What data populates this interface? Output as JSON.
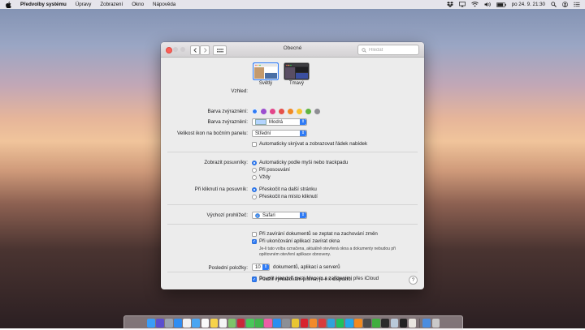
{
  "menubar": {
    "apple_icon": "apple-icon",
    "app_name": "Předvolby systému",
    "items": [
      "Úpravy",
      "Zobrazení",
      "Okno",
      "Nápověda"
    ],
    "clock": "po 24. 9.  21:30",
    "status_icons": [
      "dropbox-icon",
      "cast-icon",
      "wifi-icon",
      "volume-icon",
      "battery-icon",
      "spotlight-icon",
      "user-icon",
      "notification-center-icon"
    ]
  },
  "window": {
    "title": "Obecné",
    "search_placeholder": "Hledat",
    "appearance": {
      "label": "Vzhled:",
      "options": [
        {
          "label": "Světlý",
          "selected": true
        },
        {
          "label": "Tmavý",
          "selected": false
        }
      ]
    },
    "accent": {
      "label": "Barva zvýraznění:",
      "colors": [
        "#2f7bf5",
        "#9b4ecf",
        "#e3468a",
        "#e5504a",
        "#f08a24",
        "#f7c431",
        "#5fb541",
        "#8e8e93"
      ],
      "selected_index": 0
    },
    "highlight": {
      "label": "Barva zvýraznění:",
      "value": "Modrá",
      "swatch": "#b3d4ff"
    },
    "sidebar_icon_size": {
      "label": "Velikost ikon na bočním panelu:",
      "value": "Střední"
    },
    "auto_hide_menu": {
      "label": "Automaticky skrývat a zobrazovat řádek nabídek",
      "checked": false
    },
    "scrollbars": {
      "label": "Zobrazit posuvníky:",
      "options": [
        "Automaticky podle myši nebo trackpadu",
        "Při posouvání",
        "Vždy"
      ],
      "selected_index": 0
    },
    "click_scrollbar": {
      "label": "Při kliknutí na posuvník:",
      "options": [
        "Přeskočit na další stránku",
        "Přeskočit na místo kliknutí"
      ],
      "selected_index": 0
    },
    "default_browser": {
      "label": "Výchozí prohlížeč:",
      "value": "Safari",
      "icon": "safari-icon"
    },
    "ask_keep_changes": {
      "label": "Při zavírání dokumentů se zeptat na zachování změn",
      "checked": false
    },
    "close_windows": {
      "label": "Při ukončování aplikací zavírat okna",
      "checked": true,
      "note": "Je-li tato volba označena, aktuálně otevřená okna a dokumenty nebudou při opětovném otevření aplikace obnoveny."
    },
    "recent_items": {
      "label": "Poslední položky:",
      "value": "10",
      "suffix": "dokumentů, aplikací a serverů"
    },
    "handoff": {
      "label": "Povolit Handoff mezi Macem a zařízeními přes iCloud",
      "checked": true
    },
    "font_smoothing": {
      "label": "Použít vyhlazování písma, je-li k dispozici",
      "checked": true
    },
    "help_label": "?"
  },
  "dock": {
    "apps": [
      {
        "name": "finder-icon",
        "color": "#3a9df7"
      },
      {
        "name": "siri-icon",
        "color": "#5b4fcf"
      },
      {
        "name": "launchpad-icon",
        "color": "#9aa4b1"
      },
      {
        "name": "safari-icon",
        "color": "#2f8df2"
      },
      {
        "name": "photos-icon",
        "color": "#f2f2f2"
      },
      {
        "name": "mail-icon",
        "color": "#4aa6f2"
      },
      {
        "name": "calendar-icon",
        "color": "#fafafa"
      },
      {
        "name": "notes-icon",
        "color": "#f6d34a"
      },
      {
        "name": "reminders-icon",
        "color": "#f5f5f5"
      },
      {
        "name": "maps-icon",
        "color": "#7ec46a"
      },
      {
        "name": "photo-booth-icon",
        "color": "#c9283a"
      },
      {
        "name": "messages-icon",
        "color": "#48c75a"
      },
      {
        "name": "facetime-icon",
        "color": "#3fb54c"
      },
      {
        "name": "itunes-icon",
        "color": "#ec5ea6"
      },
      {
        "name": "app-store-icon",
        "color": "#2a8ef0"
      },
      {
        "name": "system-preferences-icon",
        "color": "#8b8f96"
      },
      {
        "name": "chrome-icon",
        "color": "#e9c532"
      },
      {
        "name": "opera-icon",
        "color": "#d8222d"
      },
      {
        "name": "firefox-icon",
        "color": "#f28a2a"
      },
      {
        "name": "vivaldi-icon",
        "color": "#d83c3c"
      },
      {
        "name": "telegram-icon",
        "color": "#2fa2db"
      },
      {
        "name": "spotify-icon",
        "color": "#1ec25a"
      },
      {
        "name": "skype-icon",
        "color": "#22a6e8"
      },
      {
        "name": "vlc-icon",
        "color": "#f08a1f"
      },
      {
        "name": "sublime-icon",
        "color": "#4a4a4a"
      },
      {
        "name": "evernote-icon",
        "color": "#3fae3e"
      },
      {
        "name": "terminal-icon",
        "color": "#2b2b2b"
      },
      {
        "name": "preview-icon",
        "color": "#b9c9d9"
      },
      {
        "name": "activity-monitor-icon",
        "color": "#222222"
      },
      {
        "name": "textedit-icon",
        "color": "#e9e6e0"
      }
    ],
    "others": [
      {
        "name": "downloads-icon",
        "color": "#4b8de0"
      },
      {
        "name": "trash-icon",
        "color": "#c9c9c9"
      }
    ]
  }
}
